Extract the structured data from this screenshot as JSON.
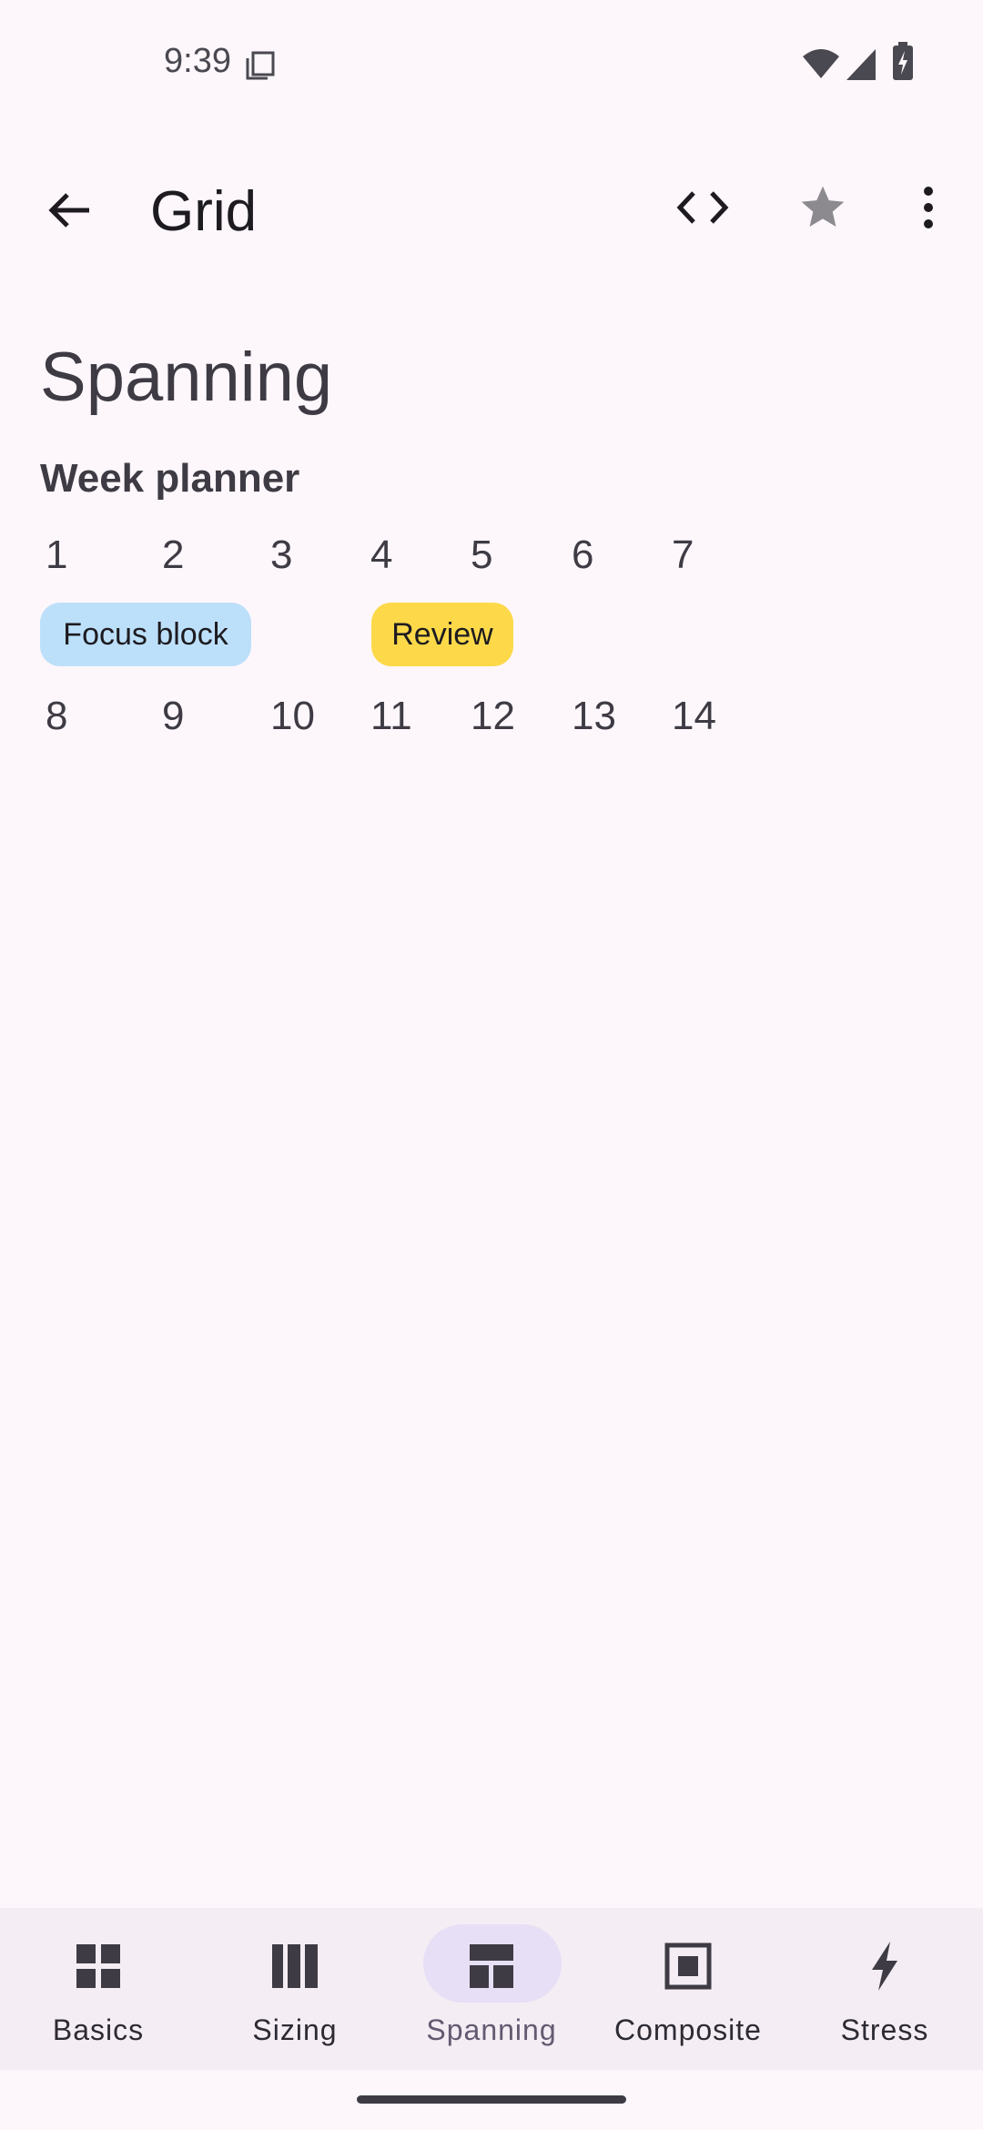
{
  "status": {
    "time": "9:39"
  },
  "topbar": {
    "title": "Grid"
  },
  "content": {
    "heading": "Spanning",
    "planner_title": "Week planner",
    "week1": [
      "1",
      "2",
      "3",
      "4",
      "5",
      "6",
      "7"
    ],
    "events": [
      {
        "label": "Focus block",
        "color": "#bde0fa"
      },
      {
        "label": "Review",
        "color": "#fdd94a"
      }
    ],
    "week2": [
      "8",
      "9",
      "10",
      "11",
      "12",
      "13",
      "14"
    ]
  },
  "nav": {
    "items": [
      {
        "label": "Basics",
        "icon": "grid-icon",
        "active": false
      },
      {
        "label": "Sizing",
        "icon": "columns-icon",
        "active": false
      },
      {
        "label": "Spanning",
        "icon": "span-layout-icon",
        "active": true
      },
      {
        "label": "Composite",
        "icon": "square-frame-icon",
        "active": false
      },
      {
        "label": "Stress",
        "icon": "bolt-icon",
        "active": false
      }
    ]
  }
}
